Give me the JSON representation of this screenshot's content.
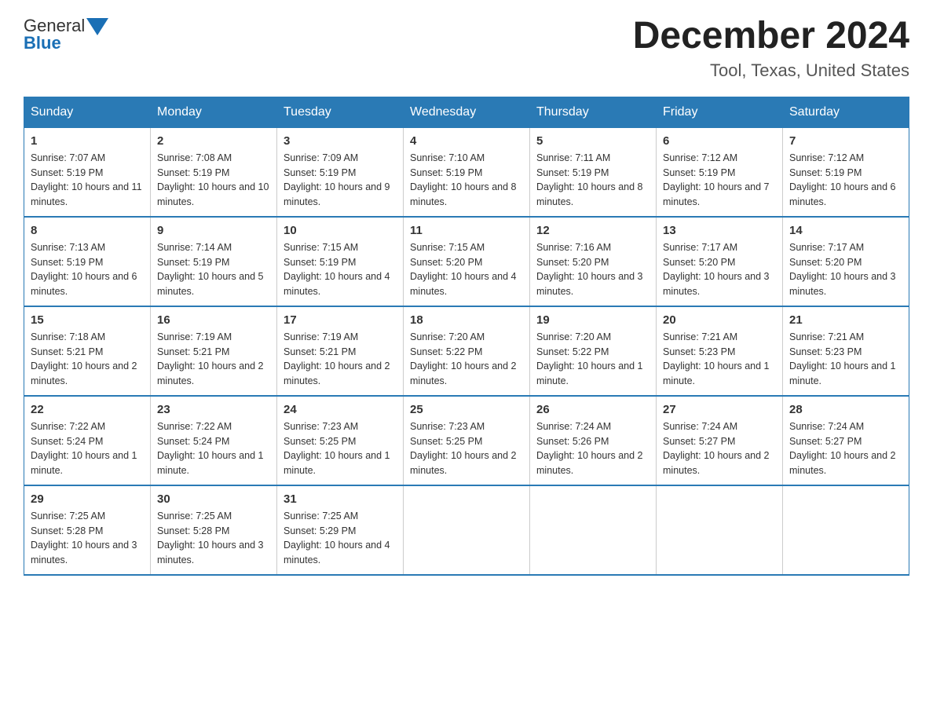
{
  "logo": {
    "text_general": "General",
    "text_blue": "Blue"
  },
  "title": "December 2024",
  "subtitle": "Tool, Texas, United States",
  "days_of_week": [
    "Sunday",
    "Monday",
    "Tuesday",
    "Wednesday",
    "Thursday",
    "Friday",
    "Saturday"
  ],
  "weeks": [
    [
      {
        "day": "1",
        "sunrise": "7:07 AM",
        "sunset": "5:19 PM",
        "daylight": "10 hours and 11 minutes."
      },
      {
        "day": "2",
        "sunrise": "7:08 AM",
        "sunset": "5:19 PM",
        "daylight": "10 hours and 10 minutes."
      },
      {
        "day": "3",
        "sunrise": "7:09 AM",
        "sunset": "5:19 PM",
        "daylight": "10 hours and 9 minutes."
      },
      {
        "day": "4",
        "sunrise": "7:10 AM",
        "sunset": "5:19 PM",
        "daylight": "10 hours and 8 minutes."
      },
      {
        "day": "5",
        "sunrise": "7:11 AM",
        "sunset": "5:19 PM",
        "daylight": "10 hours and 8 minutes."
      },
      {
        "day": "6",
        "sunrise": "7:12 AM",
        "sunset": "5:19 PM",
        "daylight": "10 hours and 7 minutes."
      },
      {
        "day": "7",
        "sunrise": "7:12 AM",
        "sunset": "5:19 PM",
        "daylight": "10 hours and 6 minutes."
      }
    ],
    [
      {
        "day": "8",
        "sunrise": "7:13 AM",
        "sunset": "5:19 PM",
        "daylight": "10 hours and 6 minutes."
      },
      {
        "day": "9",
        "sunrise": "7:14 AM",
        "sunset": "5:19 PM",
        "daylight": "10 hours and 5 minutes."
      },
      {
        "day": "10",
        "sunrise": "7:15 AM",
        "sunset": "5:19 PM",
        "daylight": "10 hours and 4 minutes."
      },
      {
        "day": "11",
        "sunrise": "7:15 AM",
        "sunset": "5:20 PM",
        "daylight": "10 hours and 4 minutes."
      },
      {
        "day": "12",
        "sunrise": "7:16 AM",
        "sunset": "5:20 PM",
        "daylight": "10 hours and 3 minutes."
      },
      {
        "day": "13",
        "sunrise": "7:17 AM",
        "sunset": "5:20 PM",
        "daylight": "10 hours and 3 minutes."
      },
      {
        "day": "14",
        "sunrise": "7:17 AM",
        "sunset": "5:20 PM",
        "daylight": "10 hours and 3 minutes."
      }
    ],
    [
      {
        "day": "15",
        "sunrise": "7:18 AM",
        "sunset": "5:21 PM",
        "daylight": "10 hours and 2 minutes."
      },
      {
        "day": "16",
        "sunrise": "7:19 AM",
        "sunset": "5:21 PM",
        "daylight": "10 hours and 2 minutes."
      },
      {
        "day": "17",
        "sunrise": "7:19 AM",
        "sunset": "5:21 PM",
        "daylight": "10 hours and 2 minutes."
      },
      {
        "day": "18",
        "sunrise": "7:20 AM",
        "sunset": "5:22 PM",
        "daylight": "10 hours and 2 minutes."
      },
      {
        "day": "19",
        "sunrise": "7:20 AM",
        "sunset": "5:22 PM",
        "daylight": "10 hours and 1 minute."
      },
      {
        "day": "20",
        "sunrise": "7:21 AM",
        "sunset": "5:23 PM",
        "daylight": "10 hours and 1 minute."
      },
      {
        "day": "21",
        "sunrise": "7:21 AM",
        "sunset": "5:23 PM",
        "daylight": "10 hours and 1 minute."
      }
    ],
    [
      {
        "day": "22",
        "sunrise": "7:22 AM",
        "sunset": "5:24 PM",
        "daylight": "10 hours and 1 minute."
      },
      {
        "day": "23",
        "sunrise": "7:22 AM",
        "sunset": "5:24 PM",
        "daylight": "10 hours and 1 minute."
      },
      {
        "day": "24",
        "sunrise": "7:23 AM",
        "sunset": "5:25 PM",
        "daylight": "10 hours and 1 minute."
      },
      {
        "day": "25",
        "sunrise": "7:23 AM",
        "sunset": "5:25 PM",
        "daylight": "10 hours and 2 minutes."
      },
      {
        "day": "26",
        "sunrise": "7:24 AM",
        "sunset": "5:26 PM",
        "daylight": "10 hours and 2 minutes."
      },
      {
        "day": "27",
        "sunrise": "7:24 AM",
        "sunset": "5:27 PM",
        "daylight": "10 hours and 2 minutes."
      },
      {
        "day": "28",
        "sunrise": "7:24 AM",
        "sunset": "5:27 PM",
        "daylight": "10 hours and 2 minutes."
      }
    ],
    [
      {
        "day": "29",
        "sunrise": "7:25 AM",
        "sunset": "5:28 PM",
        "daylight": "10 hours and 3 minutes."
      },
      {
        "day": "30",
        "sunrise": "7:25 AM",
        "sunset": "5:28 PM",
        "daylight": "10 hours and 3 minutes."
      },
      {
        "day": "31",
        "sunrise": "7:25 AM",
        "sunset": "5:29 PM",
        "daylight": "10 hours and 4 minutes."
      },
      null,
      null,
      null,
      null
    ]
  ],
  "labels": {
    "sunrise": "Sunrise:",
    "sunset": "Sunset:",
    "daylight": "Daylight:"
  }
}
